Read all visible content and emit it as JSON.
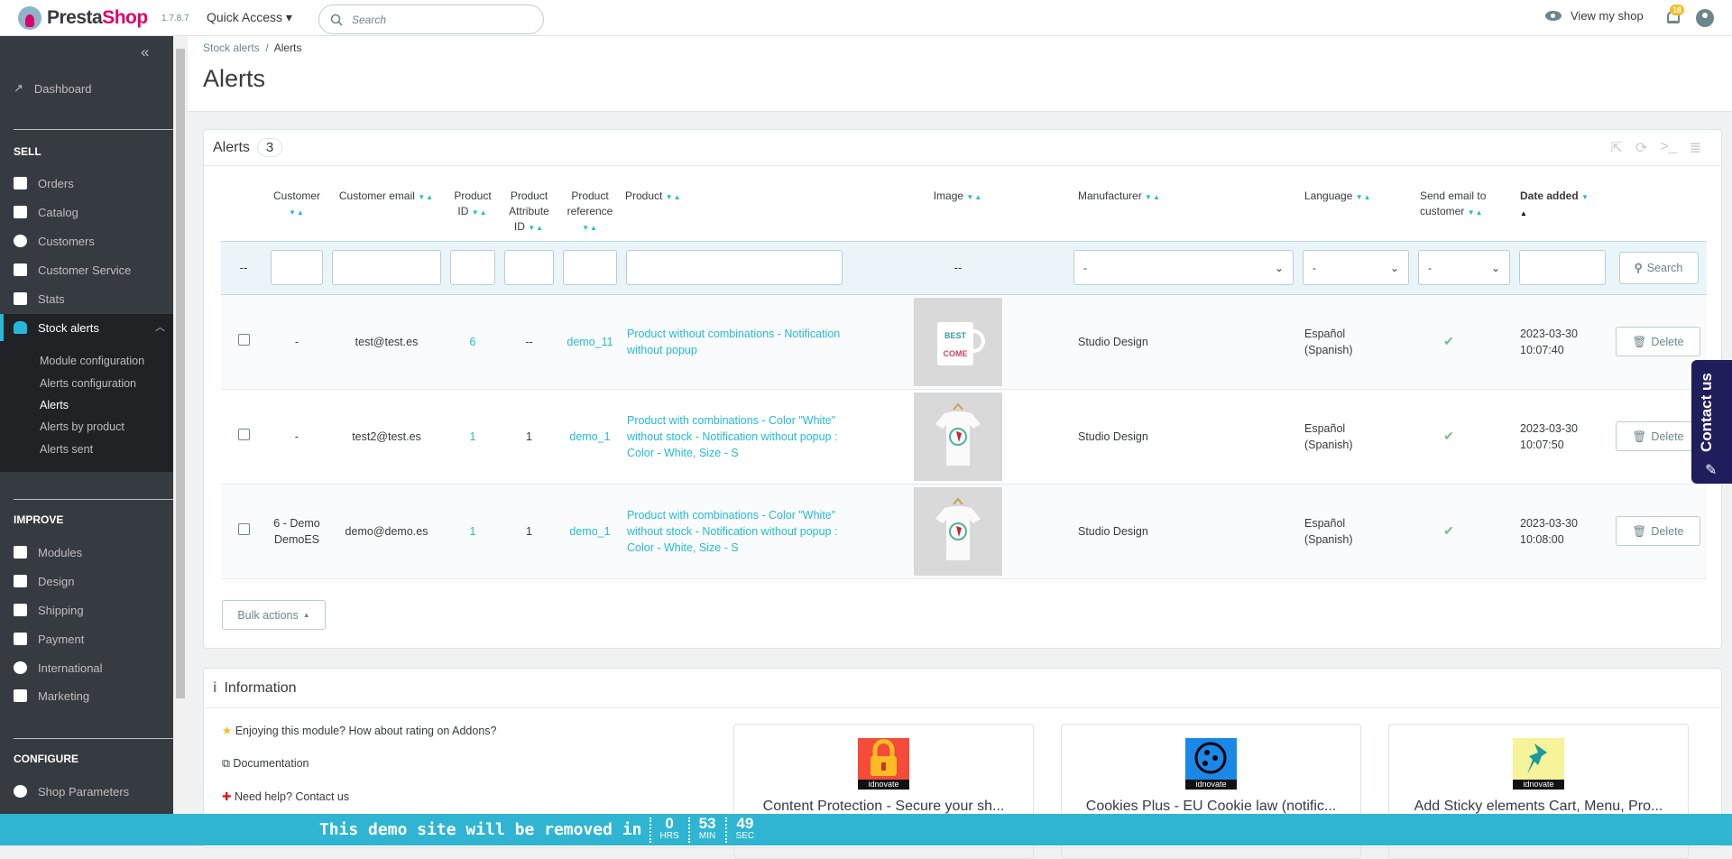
{
  "topbar": {
    "logo": "PrestaShop",
    "version": "1.7.8.7",
    "quick_access": "Quick Access",
    "search_placeholder": "Search",
    "view_shop": "View my shop",
    "notifications": "18"
  },
  "breadcrumb": {
    "parent": "Stock alerts",
    "current": "Alerts"
  },
  "page_title": "Alerts",
  "sidebar": {
    "dashboard": "Dashboard",
    "sell": "SELL",
    "sell_items": [
      "Orders",
      "Catalog",
      "Customers",
      "Customer Service",
      "Stats"
    ],
    "active": "Stock alerts",
    "sub_items": [
      "Module configuration",
      "Alerts configuration",
      "Alerts",
      "Alerts by product",
      "Alerts sent"
    ],
    "improve": "IMPROVE",
    "improve_items": [
      "Modules",
      "Design",
      "Shipping",
      "Payment",
      "International",
      "Marketing"
    ],
    "configure": "CONFIGURE",
    "configure_items": [
      "Shop Parameters"
    ]
  },
  "alerts_panel": {
    "title": "Alerts",
    "count": "3",
    "columns": [
      "Customer",
      "Customer email",
      "Product ID",
      "Product Attribute ID",
      "Product reference",
      "Product",
      "Image",
      "Manufacturer",
      "Language",
      "Send email to customer",
      "Date added"
    ],
    "filter_dash": "--",
    "image_filter": "--",
    "select_default": "-",
    "search": "Search",
    "rows": [
      {
        "customer": "-",
        "email": "test@test.es",
        "product_id": "6",
        "attr_id": "--",
        "reference": "demo_11",
        "product": "Product without combinations - Notification without popup",
        "image": "mug",
        "manufacturer": "Studio Design",
        "language": "Español (Spanish)",
        "date": "2023-03-30",
        "time": "10:07:40",
        "delete": "Delete"
      },
      {
        "customer": "-",
        "email": "test2@test.es",
        "product_id": "1",
        "attr_id": "1",
        "reference": "demo_1",
        "product": "Product with combinations - Color \"White\" without stock - Notification without popup : Color - White, Size - S",
        "image": "tshirt",
        "manufacturer": "Studio Design",
        "language": "Español (Spanish)",
        "date": "2023-03-30",
        "time": "10:07:50",
        "delete": "Delete"
      },
      {
        "customer": "6 - Demo DemoES",
        "email": "demo@demo.es",
        "product_id": "1",
        "attr_id": "1",
        "reference": "demo_1",
        "product": "Product with combinations - Color \"White\" without stock - Notification without popup : Color - White, Size - S",
        "image": "tshirt",
        "manufacturer": "Studio Design",
        "language": "Español (Spanish)",
        "date": "2023-03-30",
        "time": "10:08:00",
        "delete": "Delete"
      }
    ],
    "bulk_actions": "Bulk actions"
  },
  "info": {
    "title": "Information",
    "links": [
      "Enjoying this module? How about rating on Addons?",
      "Documentation",
      "Need help? Contact us"
    ],
    "cards": [
      {
        "title": "Content Protection - Secure your sh...",
        "brand": "idnovate",
        "color": "#f44b3b"
      },
      {
        "title": "Cookies Plus - EU Cookie law (notific...",
        "brand": "idnovate",
        "color": "#1a88e8"
      },
      {
        "title": "Add Sticky elements Cart, Menu, Pro...",
        "brand": "idnovate",
        "color": "#f7f39a"
      }
    ]
  },
  "demo_bar": {
    "text": "This demo site will be removed in",
    "hrs": "0",
    "hrs_label": "HRS",
    "min": "53",
    "min_label": "MIN",
    "sec": "49",
    "sec_label": "SEC"
  },
  "contact_tab": "Contact us",
  "colors": {
    "accent": "#25b9d7",
    "sidebar": "#363a41",
    "demo_bar": "#2fb5d2",
    "contact": "#1f1d5b"
  }
}
